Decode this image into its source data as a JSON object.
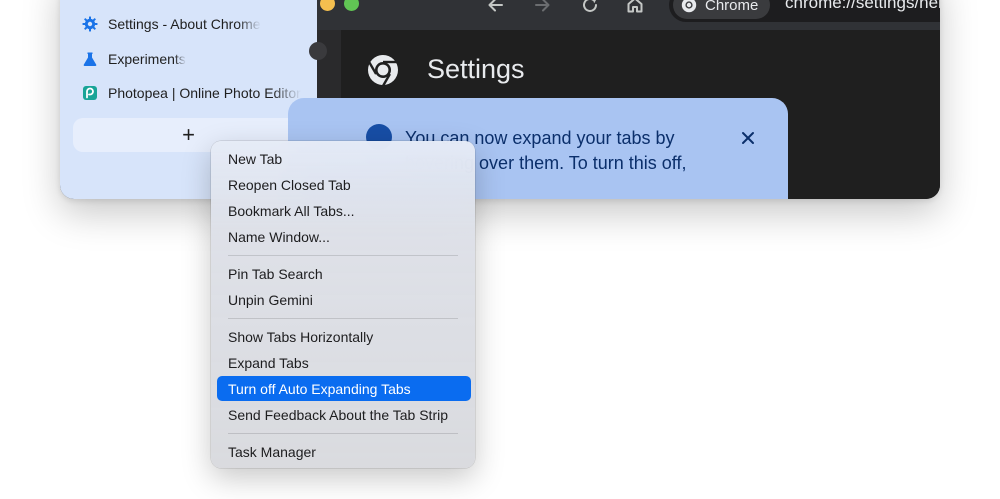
{
  "sidebar": {
    "tabs": [
      {
        "label": "Settings - About Chrome",
        "icon": "gear-icon"
      },
      {
        "label": "Experiments",
        "icon": "flask-icon"
      },
      {
        "label": "Photopea | Online Photo Editor",
        "icon": "photopea-icon"
      }
    ],
    "new_tab_label": "+"
  },
  "toolbar": {
    "chip_label": "Chrome",
    "url": "chrome://settings/help"
  },
  "content": {
    "title": "Settings"
  },
  "promo": {
    "text": "You can now expand your tabs by hovering over them. To turn this off,",
    "close_icon": "close-icon"
  },
  "menu": {
    "items": [
      "New Tab",
      "Reopen Closed Tab",
      "Bookmark All Tabs...",
      "Name Window...",
      "Pin Tab Search",
      "Unpin Gemini",
      "Show Tabs Horizontally",
      "Expand Tabs",
      "Turn off Auto Expanding Tabs",
      "Send Feedback About the Tab Strip",
      "Task Manager"
    ],
    "selected_index": 8
  },
  "colors": {
    "tab_strip": "#d7e4fa",
    "toolbar": "#303236",
    "content": "#1f1f1f",
    "promo": "#a9c4f2",
    "selection": "#0a6cf0"
  }
}
